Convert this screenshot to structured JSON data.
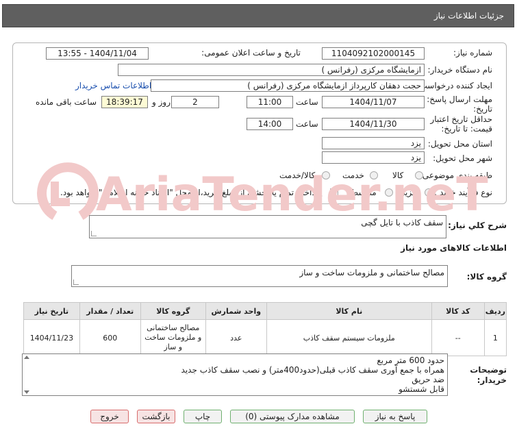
{
  "title": "جزئیات اطلاعات نیاز",
  "fields": {
    "need_number_label": "شماره نیاز:",
    "need_number": "1104092102000145",
    "announce_label": "تاریخ و ساعت اعلان عمومی:",
    "announce_value": "1404/11/04 - 13:55",
    "buyer_org_label": "نام دستگاه خریدار:",
    "buyer_org": "ازمایشگاه مرکزی (رفرانس )",
    "creator_label": "ایجاد کننده درخواست:",
    "creator": "حجت دهقان کارپرداز ازمایشگاه مرکزی (رفرانس )",
    "contact_link": "اطلاعات تماس خریدار",
    "deadline_label_1": "مهلت ارسال پاسخ: تا",
    "deadline_label_2": "تاریخ:",
    "deadline_date": "1404/11/07",
    "time_label": "ساعت",
    "deadline_time": "11:00",
    "days": "2",
    "days_label": "روز و",
    "remaining_time": "18:39:17",
    "remaining_label": "ساعت باقی مانده",
    "validity_label_1": "حداقل تاریخ اعتبار",
    "validity_label_2": "قیمت: تا تاریخ:",
    "validity_date": "1404/11/30",
    "validity_time": "14:00",
    "province_label": "استان محل تحویل:",
    "province": "یزد",
    "city_label": "شهر محل تحویل:",
    "city": "یزد",
    "category_label": "طبقه بندی موضوعی:",
    "category_options": [
      "کالا",
      "خدمت",
      "کالا/خدمت"
    ],
    "process_label": "نوع فرآیند خرید :",
    "process_options": [
      "جزیی",
      "متوسط"
    ],
    "payment_note": "پرداخت تمام یا بخشی از مبلغ خرید،از محل \"اسناد خزانه اسلامی\" خواهد بود."
  },
  "summary_label": "شرح کلي نياز:",
  "summary": "سقف کاذب با تایل گچی",
  "goods_info_title": "اطلاعات کالاهای مورد نیاز",
  "goods_group_label": "گروه کالا:",
  "goods_group": "مصالح ساختمانی و ملزومات ساخت و ساز",
  "table": {
    "headers": [
      "ردیف",
      "کد کالا",
      "نام کالا",
      "واحد شمارش",
      "گروه کالا",
      "تعداد / مقدار",
      "تاریخ نیاز"
    ],
    "rows": [
      [
        "1",
        "--",
        "ملزومات سیستم سقف کاذب",
        "عدد",
        "مصالح ساختمانی و ملزومات ساخت و ساز",
        "600",
        "1404/11/23"
      ]
    ]
  },
  "buyer_notes_label_1": "توضیحات",
  "buyer_notes_label_2": "خریدار:",
  "buyer_notes": [
    "حدود 600 متر مربع",
    "همراه با جمع آوری سقف کاذب قبلی(حدود400متر) و نصب سقف کاذب جدید",
    "ضد حریق",
    "قابل شستشو"
  ],
  "buttons": {
    "reply": "پاسخ به نیاز",
    "attachments": "مشاهده مدارک پیوستی (0)",
    "print": "چاپ",
    "back": "بازگشت",
    "exit": "خروج"
  },
  "watermark_text": "AriaTender.neT",
  "colors": {
    "title_bar": "#5f5f5f",
    "link": "#1a4fae",
    "remaining_bg": "#fdfbd5",
    "watermark": "#f2c9c9"
  }
}
